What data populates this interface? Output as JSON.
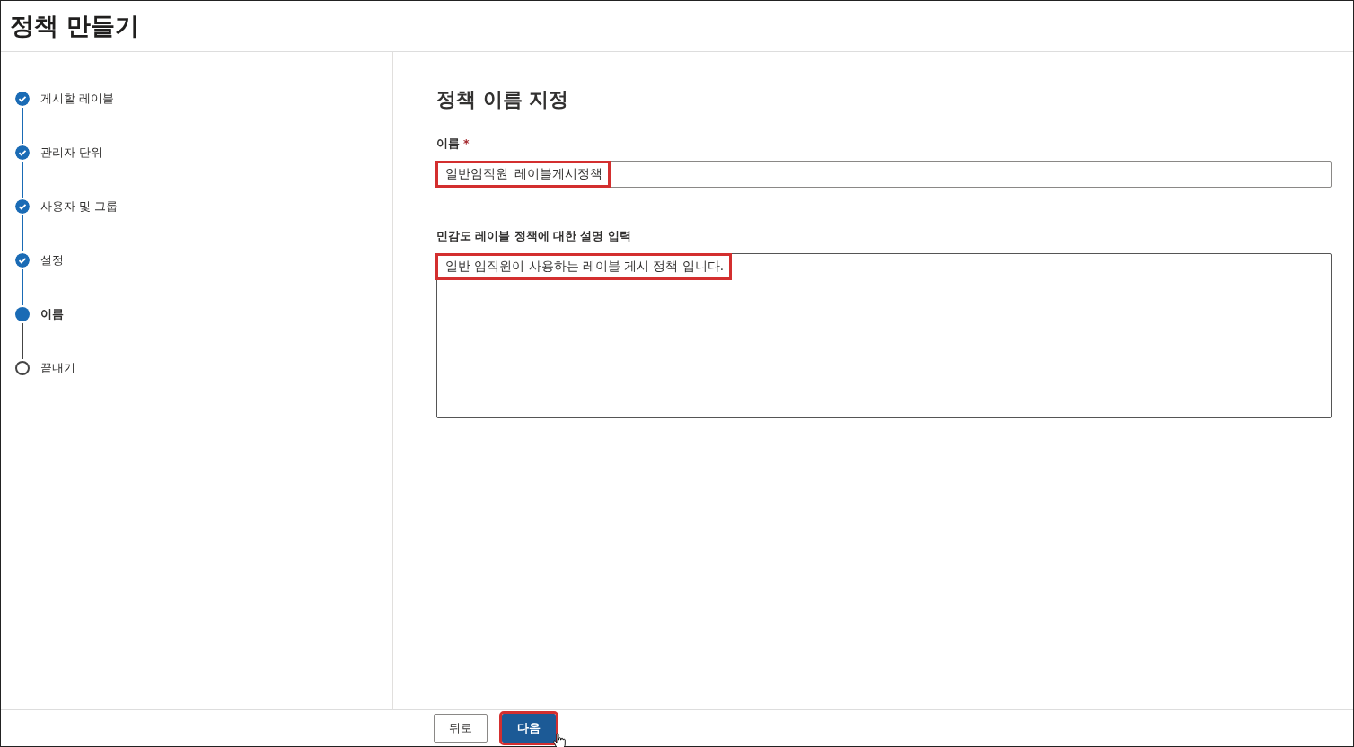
{
  "header": {
    "title": "정책 만들기"
  },
  "steps": [
    {
      "label": "게시할 레이블",
      "kind": "done",
      "selected": false
    },
    {
      "label": "관리자 단위",
      "kind": "done",
      "selected": false
    },
    {
      "label": "사용자 및 그룹",
      "kind": "done",
      "selected": false
    },
    {
      "label": "설정",
      "kind": "done",
      "selected": false
    },
    {
      "label": "이름",
      "kind": "current",
      "selected": true
    },
    {
      "label": "끝내기",
      "kind": "pending",
      "selected": false
    }
  ],
  "content": {
    "heading": "정책 이름 지정",
    "name_field": {
      "label": "이름",
      "required_mark": "*",
      "value": "일반임직원_레이블게시정책",
      "highlighted": true
    },
    "description_field": {
      "label": "민감도 레이블 정책에 대한 설명 입력",
      "value": "일반 임직원이 사용하는 레이블 게시 정책 입니다.",
      "highlighted": true
    }
  },
  "footer": {
    "buttons": [
      {
        "label": "뒤로",
        "kind": "secondary",
        "highlighted": false
      },
      {
        "label": "다음",
        "kind": "primary",
        "highlighted": true,
        "pointer": true
      }
    ]
  }
}
